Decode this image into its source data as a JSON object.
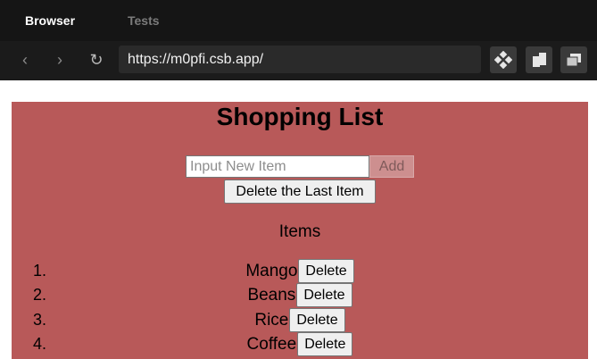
{
  "browser": {
    "tabs": [
      {
        "label": "Browser"
      },
      {
        "label": "Tests"
      }
    ],
    "url": "https://m0pfi.csb.app/"
  },
  "app": {
    "title": "Shopping List",
    "input_placeholder": "Input New Item",
    "input_value": "",
    "add_label": "Add",
    "delete_last_label": "Delete the Last Item",
    "items_heading": "Items",
    "items": [
      {
        "number": "1.",
        "name": "Mango",
        "delete_label": "Delete"
      },
      {
        "number": "2.",
        "name": "Beans",
        "delete_label": "Delete"
      },
      {
        "number": "3.",
        "name": "Rice",
        "delete_label": "Delete"
      },
      {
        "number": "4.",
        "name": "Coffee",
        "delete_label": "Delete"
      }
    ]
  },
  "colors": {
    "app_background": "#b85959",
    "chrome_background": "#1b1b1b"
  }
}
